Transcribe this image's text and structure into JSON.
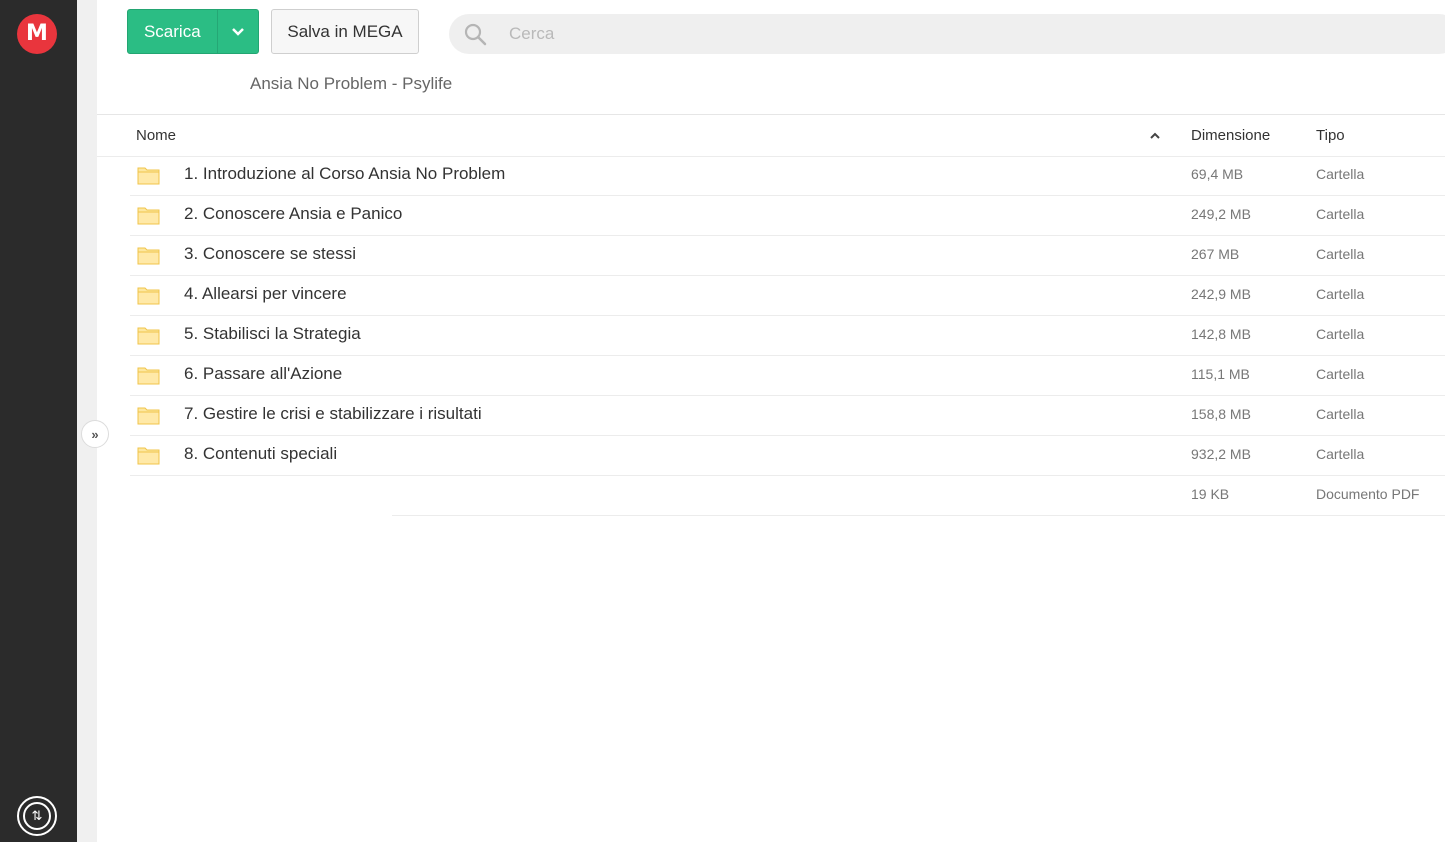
{
  "app": {
    "logo_letter": "M",
    "accent_color": "#e9353d",
    "download_color": "#2bbd84"
  },
  "toolbar": {
    "download_label": "Scarica",
    "save_label": "Salva in MEGA"
  },
  "search": {
    "placeholder": "Cerca"
  },
  "breadcrumb": {
    "title": "Ansia No Problem - Psylife"
  },
  "table": {
    "columns": {
      "name": "Nome",
      "size": "Dimensione",
      "type": "Tipo"
    },
    "rows": [
      {
        "name": "1. Introduzione al Corso Ansia No Problem",
        "size": "69,4 MB",
        "type": "Cartella",
        "icon": "folder-icon"
      },
      {
        "name": "2. Conoscere Ansia e Panico",
        "size": "249,2 MB",
        "type": "Cartella",
        "icon": "folder-icon"
      },
      {
        "name": "3. Conoscere se stessi",
        "size": "267 MB",
        "type": "Cartella",
        "icon": "folder-icon"
      },
      {
        "name": "4. Allearsi per vincere",
        "size": "242,9 MB",
        "type": "Cartella",
        "icon": "folder-icon"
      },
      {
        "name": "5. Stabilisci la Strategia",
        "size": "142,8 MB",
        "type": "Cartella",
        "icon": "folder-icon"
      },
      {
        "name": "6. Passare all'Azione",
        "size": "115,1 MB",
        "type": "Cartella",
        "icon": "folder-icon"
      },
      {
        "name": "7. Gestire le crisi e stabilizzare i risultati",
        "size": "158,8 MB",
        "type": "Cartella",
        "icon": "folder-icon"
      },
      {
        "name": "8. Contenuti speciali",
        "size": "932,2 MB",
        "type": "Cartella",
        "icon": "folder-icon"
      },
      {
        "name": "",
        "size": "19 KB",
        "type": "Documento PDF",
        "icon": ""
      }
    ]
  }
}
